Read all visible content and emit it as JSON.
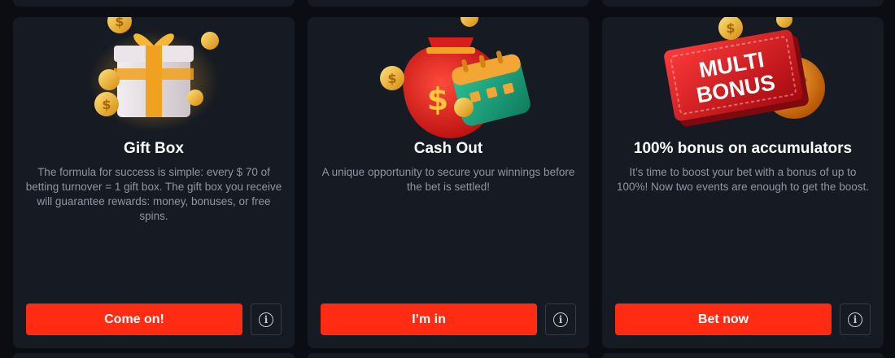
{
  "cards": [
    {
      "title": "Gift Box",
      "description": "The formula for success is simple: every $ 70 of betting turnover = 1 gift box. The gift box you receive will guarantee rewards: money, bonuses, or free spins.",
      "cta_label": "Come on!",
      "info_glyph": "i",
      "illustration": "gift-box-with-coins"
    },
    {
      "title": "Cash Out",
      "description": "A unique opportunity to secure your winnings before the bet is settled!",
      "cta_label": "I’m in",
      "info_glyph": "i",
      "illustration": "money-bag-and-calendar"
    },
    {
      "title": "100% bonus on accumulators",
      "description": "It’s time to boost your bet with a bonus of up to 100%! Now two events are enough to get the boost.",
      "cta_label": "Bet now",
      "info_glyph": "i",
      "illustration": "multi-bonus-ticket-and-ball",
      "art_text_line1": "MULTI",
      "art_text_line2": "BONUS"
    }
  ],
  "colors": {
    "page_background": "#0b0d12",
    "card_background": "#161a23",
    "accent": "#ff2b12",
    "title_text": "#ffffff",
    "body_text": "#8e95a3"
  }
}
